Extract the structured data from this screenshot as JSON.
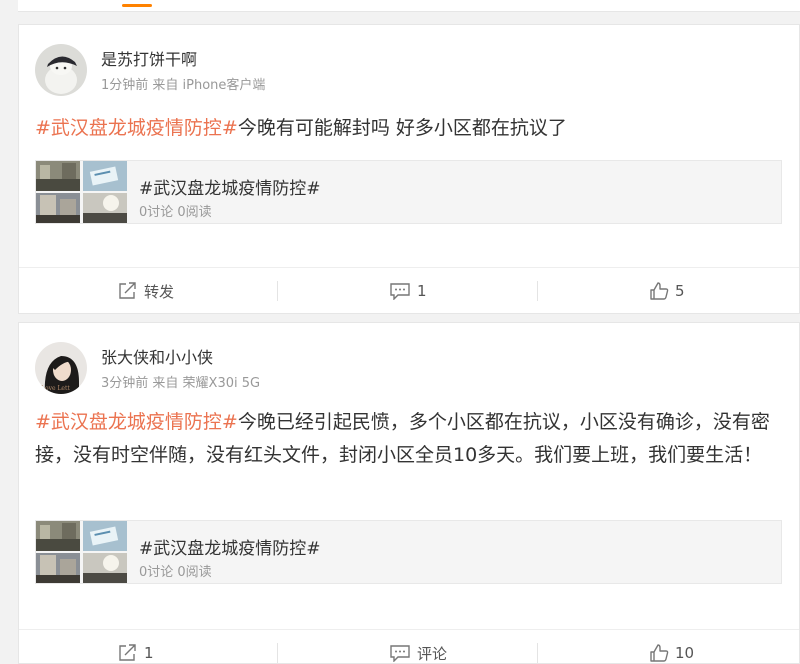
{
  "colors": {
    "hashtag": "#eb7350",
    "accent": "#ff8200"
  },
  "posts": [
    {
      "user": {
        "name": "是苏打饼干啊",
        "meta": "1分钟前 来自 iPhone客户端"
      },
      "text": {
        "hashtag": "#武汉盘龙城疫情防控#",
        "body": "今晚有可能解封吗 好多小区都在抗议了"
      },
      "topic_card": {
        "title": "#武汉盘龙城疫情防控#",
        "stats": "0讨论 0阅读"
      },
      "actions": {
        "repost": "转发",
        "comment": "1",
        "like": "5"
      }
    },
    {
      "user": {
        "name": "张大侠和小小侠",
        "meta": "3分钟前 来自 荣耀X30i 5G"
      },
      "text": {
        "hashtag": "#武汉盘龙城疫情防控#",
        "body": "今晚已经引起民愤，多个小区都在抗议，小区没有确诊，没有密接，没有时空伴随，没有红头文件，封闭小区全员10多天。我们要上班，我们要生活！"
      },
      "topic_card": {
        "title": "#武汉盘龙城疫情防控#",
        "stats": "0讨论 0阅读"
      },
      "actions": {
        "repost": "1",
        "comment": "评论",
        "like": "10"
      }
    }
  ]
}
